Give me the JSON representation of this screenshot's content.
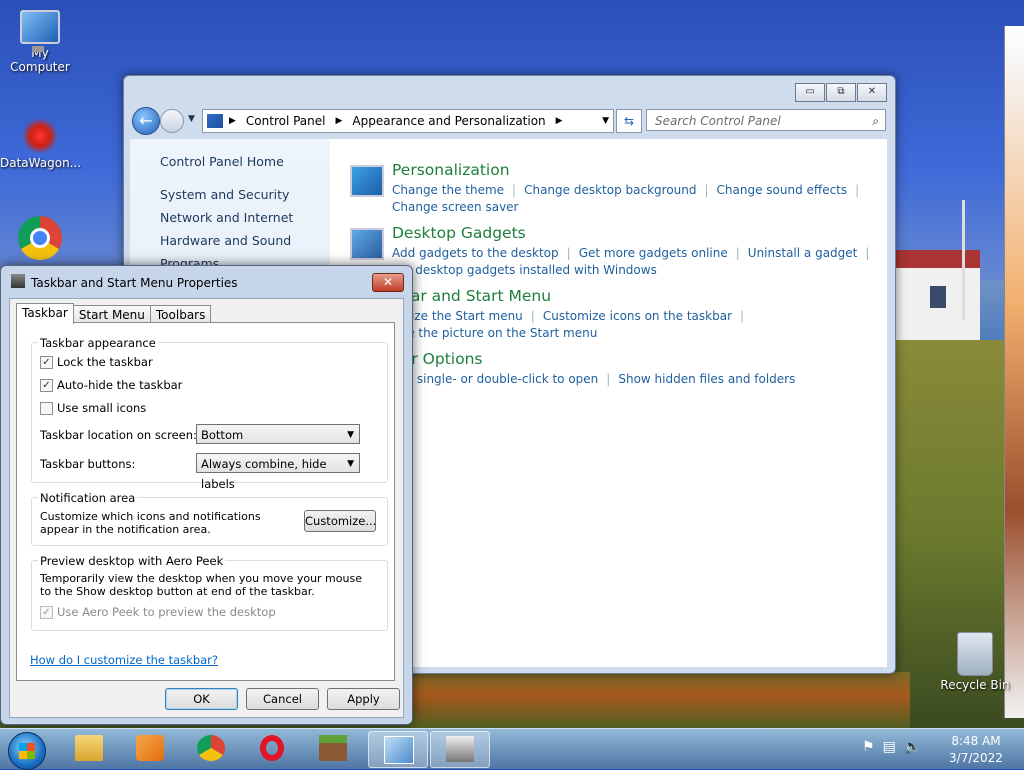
{
  "desktop": {
    "icons": [
      {
        "label": "My Computer"
      },
      {
        "label": "DataWagon..."
      },
      {
        "label": "Recycle Bin"
      }
    ]
  },
  "control_panel": {
    "caption_buttons": [
      "▭",
      "⧉",
      "✕"
    ],
    "address": {
      "crumbs": [
        "Control Panel",
        "Appearance and Personalization"
      ]
    },
    "search_placeholder": "Search Control Panel",
    "sidebar": [
      "Control Panel Home",
      "System and Security",
      "Network and Internet",
      "Hardware and Sound",
      "Programs"
    ],
    "categories": [
      {
        "title": "Personalization",
        "links": [
          "Change the theme",
          "Change desktop background",
          "Change sound effects",
          "Change screen saver"
        ]
      },
      {
        "title": "Desktop Gadgets",
        "links": [
          "Add gadgets to the desktop",
          "Get more gadgets online",
          "Uninstall a gadget",
          "ore desktop gadgets installed with Windows"
        ]
      },
      {
        "title": "kbar and Start Menu",
        "links": [
          "omize the Start menu",
          "Customize icons on the taskbar",
          "nge the picture on the Start menu"
        ]
      },
      {
        "title": "der Options",
        "links": [
          "cify single- or double-click to open",
          "Show hidden files and folders"
        ]
      }
    ]
  },
  "dialog": {
    "title": "Taskbar and Start Menu Properties",
    "close_label": "✕",
    "tabs": [
      "Taskbar",
      "Start Menu",
      "Toolbars"
    ],
    "appearance": {
      "label": "Taskbar appearance",
      "lock": {
        "label": "Lock the taskbar",
        "checked": "✓"
      },
      "autohide": {
        "label": "Auto-hide the taskbar",
        "checked": "✓"
      },
      "small_icons": {
        "label": "Use small icons",
        "checked": ""
      },
      "location_label": "Taskbar location on screen:",
      "location_value": "Bottom",
      "buttons_label": "Taskbar buttons:",
      "buttons_value": "Always combine, hide labels"
    },
    "notification": {
      "label": "Notification area",
      "text": "Customize which icons and notifications appear in the notification area.",
      "button": "Customize..."
    },
    "peek": {
      "label": "Preview desktop with Aero Peek",
      "text": "Temporarily view the desktop when you move your mouse to the Show desktop button at end of the taskbar.",
      "checkbox": {
        "label": "Use Aero Peek to preview the desktop",
        "checked": "✓"
      }
    },
    "help_link": "How do I customize the taskbar?",
    "buttons": {
      "ok": "OK",
      "cancel": "Cancel",
      "apply": "Apply"
    }
  },
  "taskbar": {
    "items": [
      "file-explorer-icon",
      "media-player-icon",
      "chrome-icon",
      "opera-icon",
      "minecraft-icon",
      "control-panel-icon",
      "taskbar-properties-icon"
    ],
    "tray_icons": [
      "action-center-icon",
      "network-icon",
      "volume-icon"
    ],
    "time": "8:48 AM",
    "date": "3/7/2022"
  }
}
